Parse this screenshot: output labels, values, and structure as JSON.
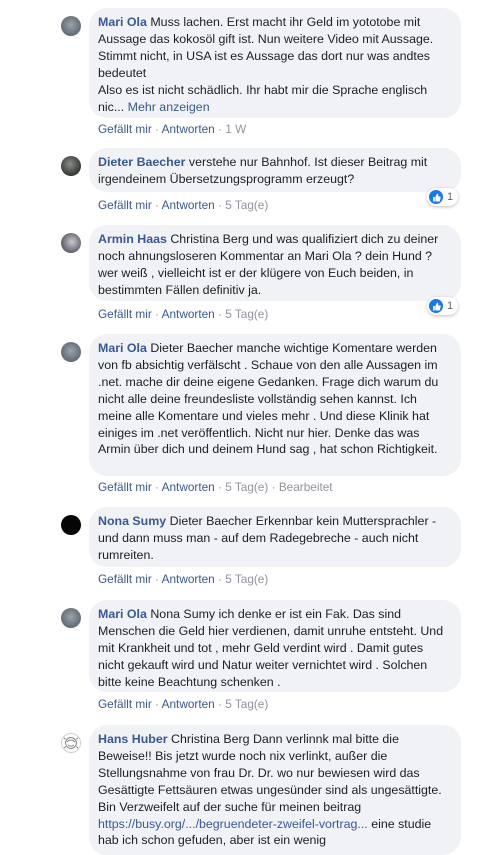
{
  "ui": {
    "like": "Gefällt mir",
    "reply": "Antworten",
    "separator": "·"
  },
  "comments": [
    {
      "author": "Mari Ola",
      "text": "Muss lachen. Erst macht ihr Geld im yototobe mit Aussage das kokosöl gift ist. Nun weitere Video mit Aussage. Stimmt nicht, in USA ist es Aussage das dort nur was andtes bedeutet\nAlso es ist nicht schädlich. Ihr habt mir die Sprache englisch nic...",
      "more": "Mehr anzeigen",
      "time": "1 W"
    },
    {
      "author": "Dieter Baecher",
      "text": "verstehe nur Bahnhof. Ist dieser Beitrag mit irgendeinem Übersetzungsprogramm erzeugt?",
      "time": "5 Tag(e)",
      "reaction_count": "1"
    },
    {
      "author": "Armin Haas",
      "text": "Christina Berg und was qualifiziert dich zu deiner noch ahnungsloseren Kommentar an Mari Ola ? dein Hund ? wer weiß , vielleicht ist er der klügere von Euch beiden, in bestimmten Fällen definitiv ja.",
      "time": "5 Tag(e)",
      "reaction_count": "1"
    },
    {
      "author": "Mari Ola",
      "text": "Dieter Baecher manche wichtige Komentare werden von fb absichtig verfälscht . Schaue von den alle Aussagen im .net. mache dir deine eigene Gedanken. Frage dich warum du nicht alle deine freundesliste vollständig sehen kannst. Ich meine alle Komentare und vieles mehr . Und diese Klinik hat einiges im .net veröffentlich. Nicht nur hier. Denke das was Armin über dich und deinem Hund sag , hat schon Richtigkeit.",
      "time": "5 Tag(e)",
      "edited": "Bearbeitet"
    },
    {
      "author": "Nona Sumy",
      "text": "Dieter Baecher Erkennbar kein Muttersprachler - und dann muss man - auf dem Radegebreche - auch nicht rumreiten.",
      "time": "5 Tag(e)"
    },
    {
      "author": "Mari Ola",
      "text": "Nona Sumy ich denke er ist ein Fak. Das sind Menschen die Geld hier verdienen, damit unruhe entsteht. Und mit Krankheit und tot , mehr Geld verdint wird . Damit gutes nicht gekauft wird und Natur weiter vernichtet wird . Solchen bitte keine Beachtung schenken .",
      "time": "5 Tag(e)"
    },
    {
      "author": "Hans Huber",
      "text": "Christina Berg Dann verlinnk mal bitte die Beweise!! Bis jetzt wurde noch nix verlinkt, außer die Stellungsnahme von frau Dr. Dr. wo nur bewiesen wird das Gesättigte Fettsäuren etwas ungesünder sind als ungesättigte. Bin Verzweifelt auf der suche für meinen beitrag",
      "link": "https://busy.org/.../begruendeter-zweifel-vortrag...",
      "text_after": "eine studie hab ich schon gefuden, aber ist ein wenig"
    }
  ]
}
